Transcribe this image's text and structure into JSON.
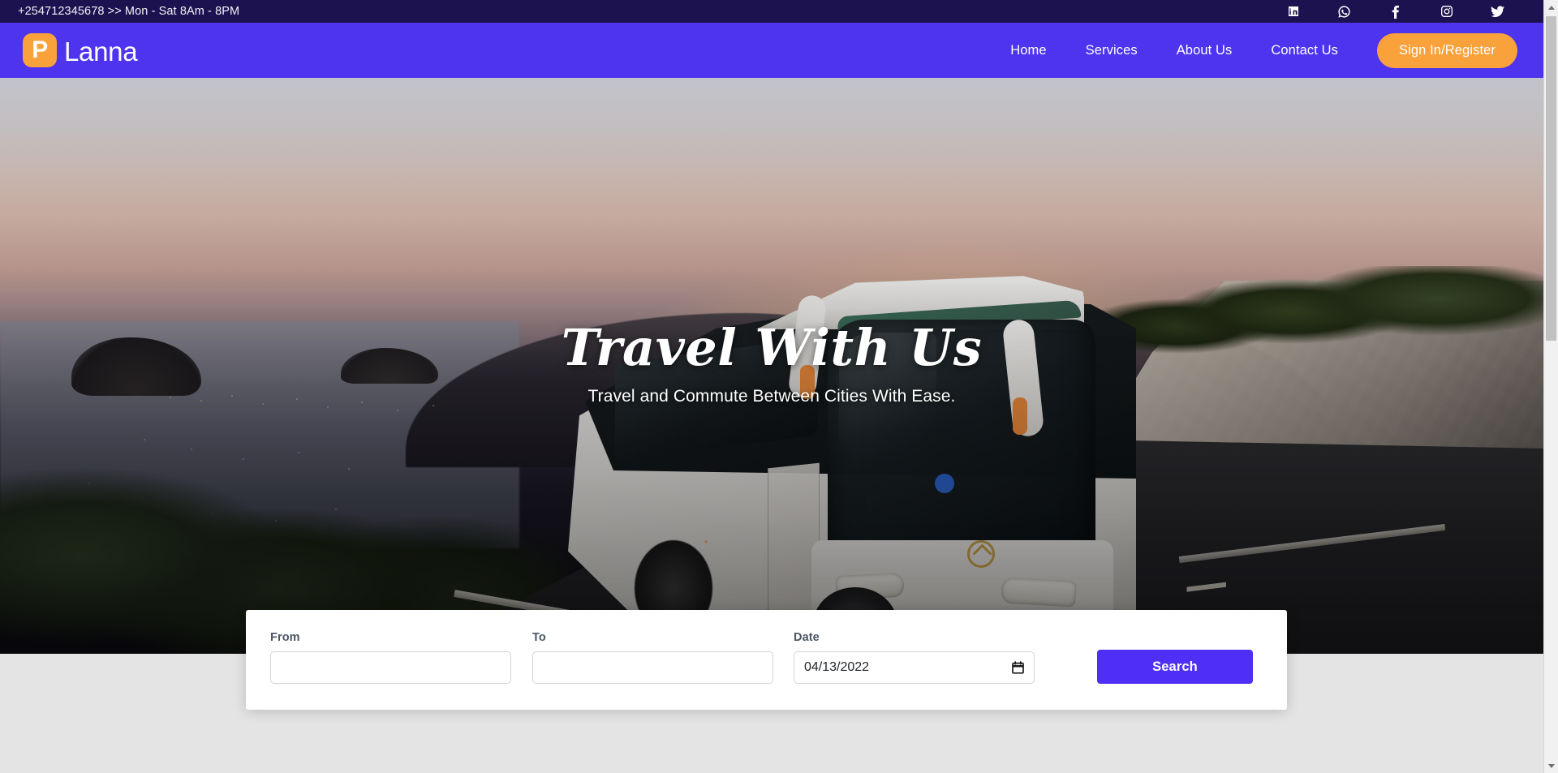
{
  "topbar": {
    "contact": "+254712345678 >> Mon - Sat 8Am - 8PM",
    "social": [
      {
        "name": "linkedin-icon",
        "label": "LinkedIn"
      },
      {
        "name": "whatsapp-icon",
        "label": "WhatsApp"
      },
      {
        "name": "facebook-icon",
        "label": "Facebook"
      },
      {
        "name": "instagram-icon",
        "label": "Instagram"
      },
      {
        "name": "twitter-icon",
        "label": "Twitter"
      }
    ]
  },
  "brand": {
    "mark": "P",
    "name": "Lanna",
    "mark_color": "#f9a23c",
    "bar_color": "#4e33ef"
  },
  "nav": {
    "links": [
      {
        "label": "Home"
      },
      {
        "label": "Services"
      },
      {
        "label": "About Us"
      },
      {
        "label": "Contact Us"
      }
    ],
    "cta_label": "Sign In/Register",
    "cta_color": "#f9a23c"
  },
  "hero": {
    "title": "Travel With Us",
    "subtitle": "Travel and Commute Between Cities With Ease."
  },
  "search": {
    "from": {
      "label": "From",
      "value": "",
      "placeholder": ""
    },
    "to": {
      "label": "To",
      "value": "",
      "placeholder": ""
    },
    "date": {
      "label": "Date",
      "value": "04/13/2022",
      "icon": "calendar-icon"
    },
    "button_label": "Search",
    "button_color": "#4f2ff5"
  },
  "scrollbar": {
    "up_arrow": "scroll-up-arrow",
    "down_arrow": "scroll-down-arrow"
  }
}
